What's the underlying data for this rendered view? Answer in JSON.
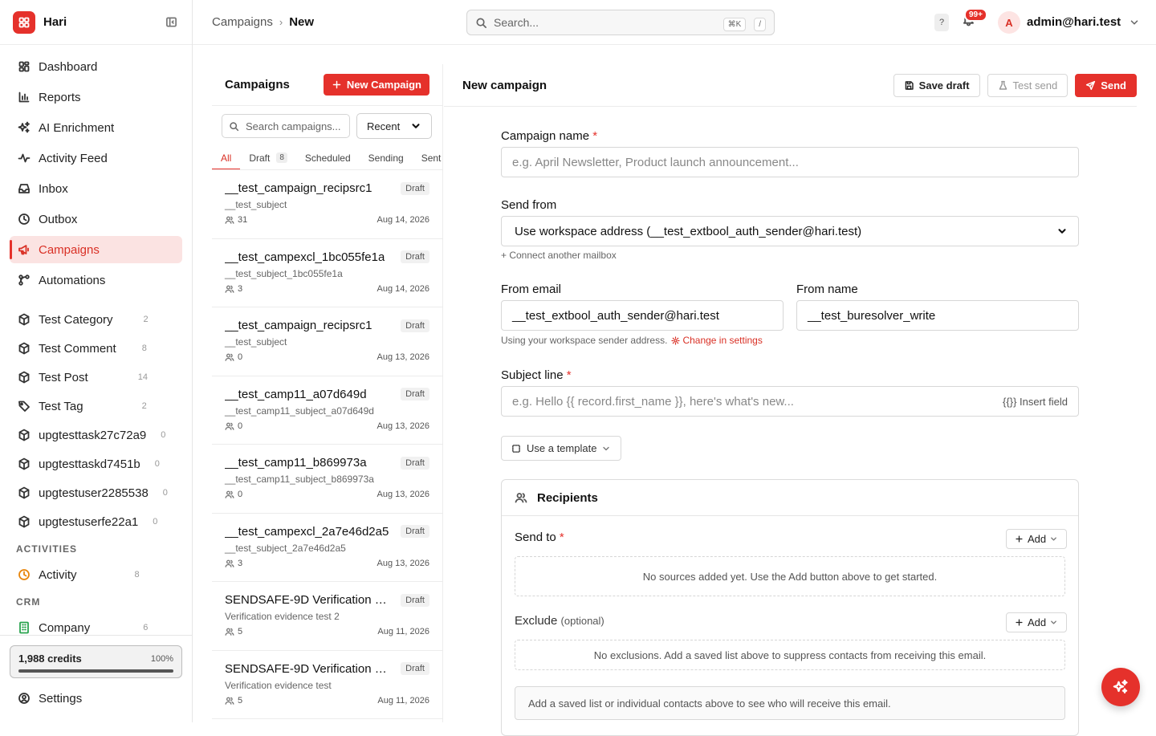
{
  "app": {
    "name": "Hari",
    "accent": "#e5312b"
  },
  "sidebar": {
    "nav": [
      {
        "label": "Dashboard",
        "icon": "dashboard-icon"
      },
      {
        "label": "Reports",
        "icon": "bar-chart-icon"
      },
      {
        "label": "AI Enrichment",
        "icon": "sparkles-icon"
      },
      {
        "label": "Activity Feed",
        "icon": "activity-icon"
      },
      {
        "label": "Inbox",
        "icon": "inbox-icon"
      },
      {
        "label": "Outbox",
        "icon": "clock-icon"
      },
      {
        "label": "Campaigns",
        "icon": "megaphone-icon",
        "active": true
      },
      {
        "label": "Automations",
        "icon": "workflow-icon"
      }
    ],
    "objects": [
      {
        "label": "Test Category",
        "count": "2",
        "icon": "cube-icon"
      },
      {
        "label": "Test Comment",
        "count": "8",
        "icon": "cube-icon"
      },
      {
        "label": "Test Post",
        "count": "14",
        "icon": "cube-icon"
      },
      {
        "label": "Test Tag",
        "count": "2",
        "icon": "tag-icon"
      },
      {
        "label": "upgtesttask27c72a9",
        "count": "0",
        "icon": "cube-icon"
      },
      {
        "label": "upgtesttaskd7451b",
        "count": "0",
        "icon": "cube-icon"
      },
      {
        "label": "upgtestuser2285538",
        "count": "0",
        "icon": "cube-icon"
      },
      {
        "label": "upgtestuserfe22a1",
        "count": "0",
        "icon": "cube-icon"
      }
    ],
    "activities_heading": "ACTIVITIES",
    "activities": [
      {
        "label": "Activity",
        "count": "8"
      }
    ],
    "crm_heading": "CRM",
    "crm": [
      {
        "label": "Company",
        "count": "6"
      }
    ],
    "credits": {
      "label": "1,988 credits",
      "percent_text": "100%",
      "fill": 1.0
    },
    "settings_label": "Settings"
  },
  "topbar": {
    "breadcrumb": [
      "Campaigns",
      "New"
    ],
    "search_placeholder": "Search...",
    "kbd1": "⌘K",
    "kbd2": "/",
    "help": "?",
    "notif_badge": "99+",
    "avatar_letter": "A",
    "user": "admin@hari.test"
  },
  "list": {
    "title": "Campaigns",
    "new_button": "New Campaign",
    "search_placeholder": "Search campaigns...",
    "sort": "Recent",
    "tabs": [
      {
        "label": "All",
        "count": null
      },
      {
        "label": "Draft",
        "count": "8"
      },
      {
        "label": "Scheduled",
        "count": null
      },
      {
        "label": "Sending",
        "count": null
      },
      {
        "label": "Sent",
        "count": null
      }
    ],
    "campaigns": [
      {
        "name": "__test_campaign_recipsrc1",
        "subject": "__test_subject",
        "recipients": "31",
        "date": "Aug 14, 2026",
        "status": "Draft"
      },
      {
        "name": "__test_campexcl_1bc055fe1a",
        "subject": "__test_subject_1bc055fe1a",
        "recipients": "3",
        "date": "Aug 14, 2026",
        "status": "Draft"
      },
      {
        "name": "__test_campaign_recipsrc1",
        "subject": "__test_subject",
        "recipients": "0",
        "date": "Aug 13, 2026",
        "status": "Draft"
      },
      {
        "name": "__test_camp11_a07d649d",
        "subject": "__test_camp11_subject_a07d649d",
        "recipients": "0",
        "date": "Aug 13, 2026",
        "status": "Draft"
      },
      {
        "name": "__test_camp11_b869973a",
        "subject": "__test_camp11_subject_b869973a",
        "recipients": "0",
        "date": "Aug 13, 2026",
        "status": "Draft"
      },
      {
        "name": "__test_campexcl_2a7e46d2a5",
        "subject": "__test_subject_2a7e46d2a5",
        "recipients": "3",
        "date": "Aug 13, 2026",
        "status": "Draft"
      },
      {
        "name": "SENDSAFE-9D Verification C...",
        "subject": "Verification evidence test 2",
        "recipients": "5",
        "date": "Aug 11, 2026",
        "status": "Draft"
      },
      {
        "name": "SENDSAFE-9D Verification C...",
        "subject": "Verification evidence test",
        "recipients": "5",
        "date": "Aug 11, 2026",
        "status": "Draft"
      }
    ]
  },
  "form": {
    "title": "New campaign",
    "save_draft": "Save draft",
    "test_send": "Test send",
    "send": "Send",
    "campaign_name_label": "Campaign name",
    "campaign_name_placeholder": "e.g. April Newsletter, Product launch announcement...",
    "send_from_label": "Send from",
    "send_from_value": "Use workspace address (__test_extbool_auth_sender@hari.test)",
    "connect_mailbox": "+ Connect another mailbox",
    "from_email_label": "From email",
    "from_email_value": "__test_extbool_auth_sender@hari.test",
    "from_name_label": "From name",
    "from_name_value": "__test_buresolver_write",
    "sender_hint": "Using your workspace sender address.",
    "change_settings": "Change in settings",
    "subject_label": "Subject line",
    "subject_placeholder": "e.g. Hello {{ record.first_name }}, here's what's new...",
    "insert_field": "{{}} Insert field",
    "use_template": "Use a template",
    "recipients_title": "Recipients",
    "send_to_label": "Send to",
    "add": "Add",
    "send_to_empty": "No sources added yet. Use the Add button above to get started.",
    "exclude_label": "Exclude",
    "exclude_optional": "(optional)",
    "exclude_empty": "No exclusions. Add a saved list above to suppress contacts from receiving this email.",
    "recipients_note": "Add a saved list or individual contacts above to see who will receive this email."
  }
}
